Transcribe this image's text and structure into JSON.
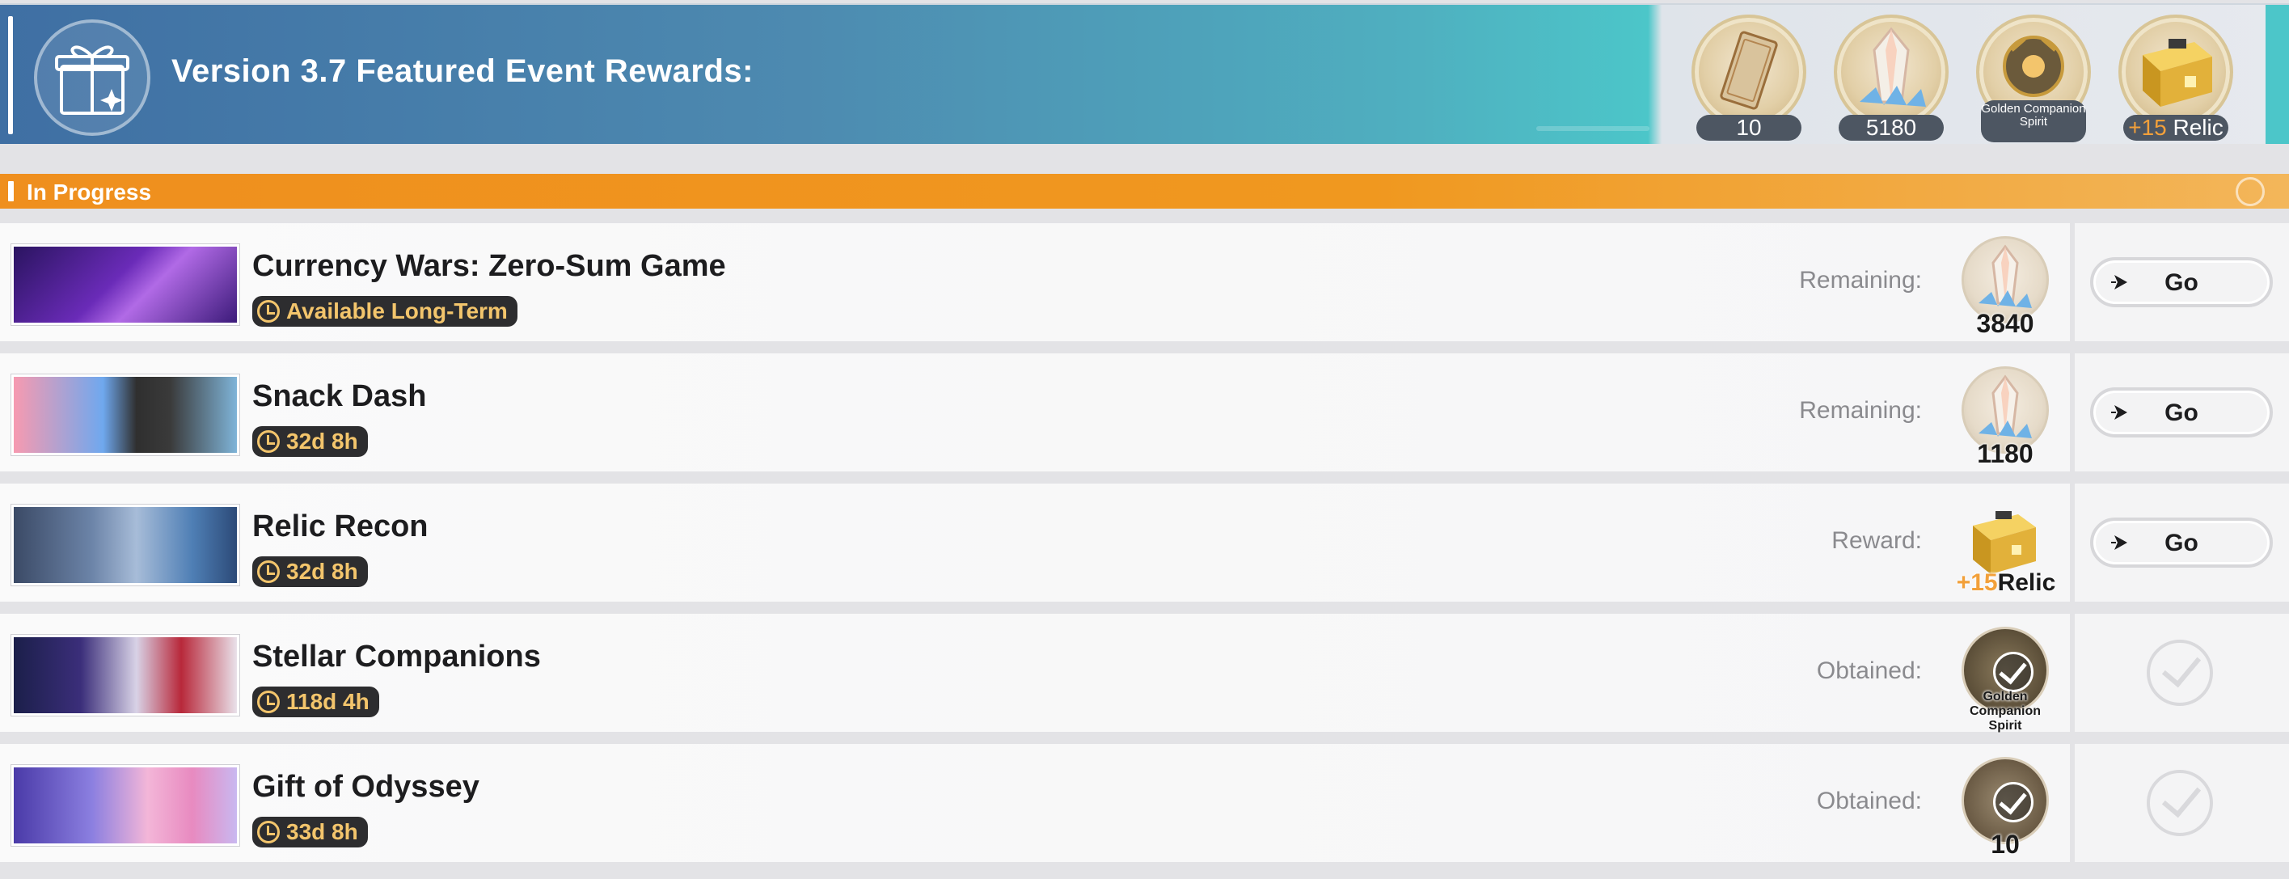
{
  "header": {
    "title": "Version 3.7 Featured Event Rewards:",
    "rewards": [
      {
        "icon": "ticket-icon",
        "label": "10"
      },
      {
        "icon": "stellar-jade-icon",
        "label": "5180"
      },
      {
        "icon": "golden-companion-spirit-icon",
        "label": "Golden Companion Spirit"
      },
      {
        "icon": "relic-box-icon",
        "prefix": "+15",
        "label": "Relic"
      }
    ]
  },
  "section": {
    "label": "In Progress"
  },
  "events": [
    {
      "title": "Currency Wars: Zero-Sum Game",
      "timer": "Available Long-Term",
      "status_label": "Remaining:",
      "reward_icon": "stellar-jade-icon",
      "reward_qty": "3840",
      "action": "Go"
    },
    {
      "title": "Snack Dash",
      "timer": "32d 8h",
      "status_label": "Remaining:",
      "reward_icon": "stellar-jade-icon",
      "reward_qty": "1180",
      "action": "Go"
    },
    {
      "title": "Relic Recon",
      "timer": "32d 8h",
      "status_label": "Reward:",
      "reward_icon": "relic-box-icon",
      "reward_prefix": "+15",
      "reward_qty": "Relic",
      "action": "Go"
    },
    {
      "title": "Stellar Companions",
      "timer": "118d 4h",
      "status_label": "Obtained:",
      "reward_icon": "golden-companion-spirit-icon",
      "reward_qty": "Golden Companion Spirit",
      "action": ""
    },
    {
      "title": "Gift of Odyssey",
      "timer": "33d 8h",
      "status_label": "Obtained:",
      "reward_icon": "ticket-icon",
      "reward_qty": "10",
      "action": ""
    }
  ],
  "colors": {
    "accent_orange": "#f0981f",
    "banner_teal": "#4cc6c9",
    "timer_gold": "#f3c56c"
  }
}
